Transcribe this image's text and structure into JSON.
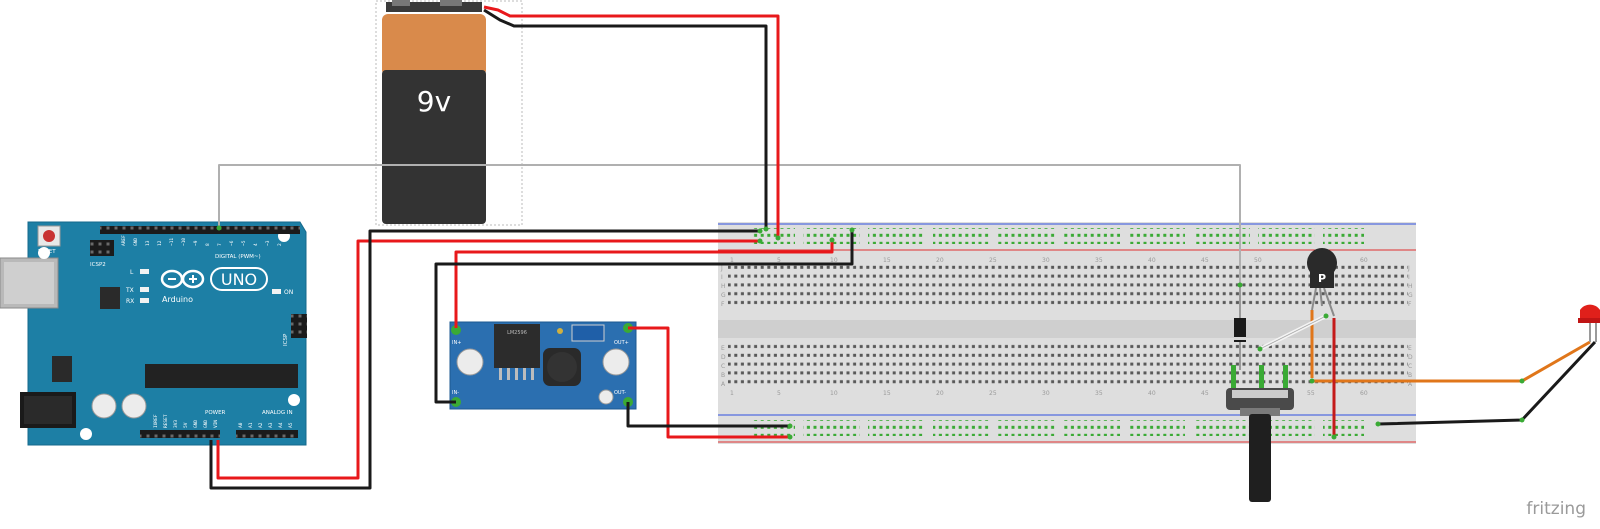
{
  "battery": {
    "label": "9v"
  },
  "arduino": {
    "brand": "Arduino",
    "model": "UNO",
    "reset": "RESET",
    "icsp": "ICSP2",
    "icsp_side": "ICSP",
    "digital": "DIGITAL (PWM~)",
    "power": "POWER",
    "analog": "ANALOG IN",
    "led_l": "L",
    "led_tx": "TX",
    "led_rx": "RX",
    "led_on": "ON",
    "digital_pins": [
      "AREF",
      "GND",
      "13",
      "12",
      "~11",
      "~10",
      "~9",
      "8",
      "7",
      "~6",
      "~5",
      "4",
      "~3",
      "2",
      "TX▸1",
      "RX◂0"
    ],
    "power_pins": [
      "IOREF",
      "RESET",
      "3V3",
      "5V",
      "GND",
      "GND",
      "VIN"
    ],
    "analog_pins": [
      "A0",
      "A1",
      "A2",
      "A3",
      "A4",
      "A5"
    ]
  },
  "regulator": {
    "in_plus": "IN+",
    "in_minus": "IN-",
    "out_plus": "OUT+",
    "out_minus": "OUT-",
    "chip": "LM2596"
  },
  "transistor": {
    "label": "P"
  },
  "breadboard": {
    "column_numbers": [
      "1",
      "5",
      "10",
      "15",
      "20",
      "25",
      "30",
      "35",
      "40",
      "45",
      "50",
      "55",
      "60"
    ],
    "row_letters_top": [
      "J",
      "I",
      "H",
      "G",
      "F"
    ],
    "row_letters_bottom": [
      "E",
      "D",
      "C",
      "B",
      "A"
    ]
  },
  "colors": {
    "wire_red": "#e8181b",
    "wire_black": "#1a1a1a",
    "wire_gray": "#b0b0b0",
    "wire_orange": "#e0761a",
    "wire_white": "#f4f4f4",
    "board_teal": "#1d7fa5",
    "module_blue": "#2b6fb0",
    "breadboard": "#dcdcdc",
    "led_red": "#e0201b",
    "battery_copper": "#d98a4b",
    "battery_body": "#333333",
    "hole_green": "#3aaa35"
  },
  "footer": {
    "brand": "fritzing"
  }
}
